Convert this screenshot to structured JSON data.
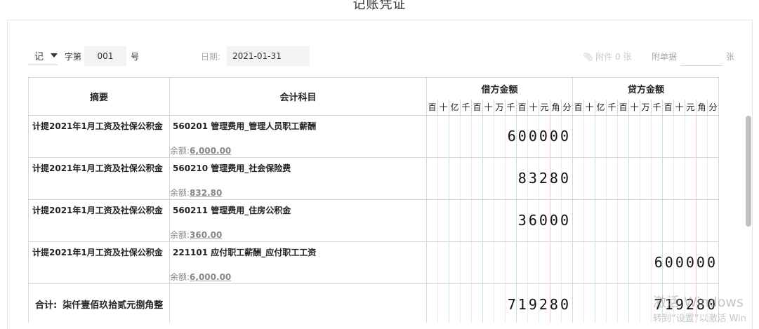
{
  "page": {
    "title": "记账凭证"
  },
  "header": {
    "voucher_type": "记",
    "word_label": "字第",
    "voucher_no": "001",
    "no_suffix": "号",
    "date_label": "日期:",
    "date_value": "2021-01-31",
    "attachment_link": "附件 0 张",
    "attach_doc_label": "附单据",
    "attach_doc_value": "",
    "attach_unit": "张"
  },
  "table": {
    "headers": {
      "summary": "摘要",
      "account": "会计科目",
      "debit": "借方金额",
      "credit": "贷方金额"
    },
    "digit_units": [
      "百",
      "十",
      "亿",
      "千",
      "百",
      "十",
      "万",
      "千",
      "百",
      "十",
      "元",
      "角",
      "分"
    ],
    "balance_label": "余额:",
    "rows": [
      {
        "summary": "计提2021年1月工资及社保公积金",
        "account": "560201 管理费用_管理人员职工薪酬",
        "balance": "6,000.00",
        "debit": "600000",
        "credit": ""
      },
      {
        "summary": "计提2021年1月工资及社保公积金",
        "account": "560210 管理费用_社会保险费",
        "balance": "832.80",
        "debit": "83280",
        "credit": ""
      },
      {
        "summary": "计提2021年1月工资及社保公积金",
        "account": "560211 管理费用_住房公积金",
        "balance": "360.00",
        "debit": "36000",
        "credit": ""
      },
      {
        "summary": "计提2021年1月工资及社保公积金",
        "account": "221101 应付职工薪酬_应付职工工资",
        "balance": "6,000.00",
        "debit": "",
        "credit": "600000"
      }
    ],
    "total": {
      "label": "合计:",
      "amount_text": "柒仟壹佰玖拾贰元捌角整",
      "debit": "719280",
      "credit": "719280"
    }
  },
  "overlay": {
    "watermark_line1": "激活 Windows",
    "watermark_line2": "转到“设置”以激活 Win"
  }
}
